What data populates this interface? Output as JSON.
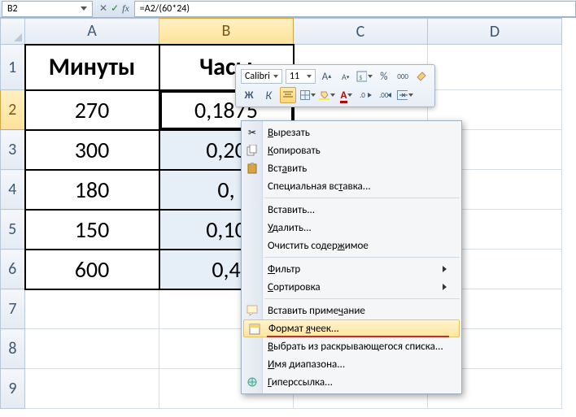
{
  "name_box": "B2",
  "formula": "=A2/(60*24)",
  "columns": [
    "A",
    "B",
    "C",
    "D"
  ],
  "selected_col": "B",
  "rows": [
    "1",
    "2",
    "3",
    "4",
    "5",
    "6",
    "7",
    "8",
    "9"
  ],
  "selected_row": "2",
  "mini": {
    "font": "Calibri",
    "size": "11",
    "bold": "Ж",
    "italic": "К",
    "fontcolor_letter": "A",
    "percent": "%",
    "thousands": "000"
  },
  "table": {
    "headers": {
      "a": "Минуты",
      "b": "Часы"
    },
    "rows": [
      {
        "a": "270",
        "b": "0,1875"
      },
      {
        "a": "300",
        "b": "0,20"
      },
      {
        "a": "180",
        "b": "0,"
      },
      {
        "a": "150",
        "b": "0,10"
      },
      {
        "a": "600",
        "b": "0,4"
      }
    ]
  },
  "ctx": {
    "cut": "Вырезать",
    "copy": "Копировать",
    "paste": "Вставить",
    "paste_special": "Специальная вставка...",
    "insert": "Вставить...",
    "delete": "Удалить...",
    "clear": "Очистить содержимое",
    "filter": "Фильтр",
    "sort": "Сортировка",
    "comment": "Вставить примечание",
    "format_cells": "Формат ячеек...",
    "dropdown_pick": "Выбрать из раскрывающегося списка...",
    "name_range": "Имя диапазона...",
    "hyperlink": "Гиперссылка..."
  }
}
